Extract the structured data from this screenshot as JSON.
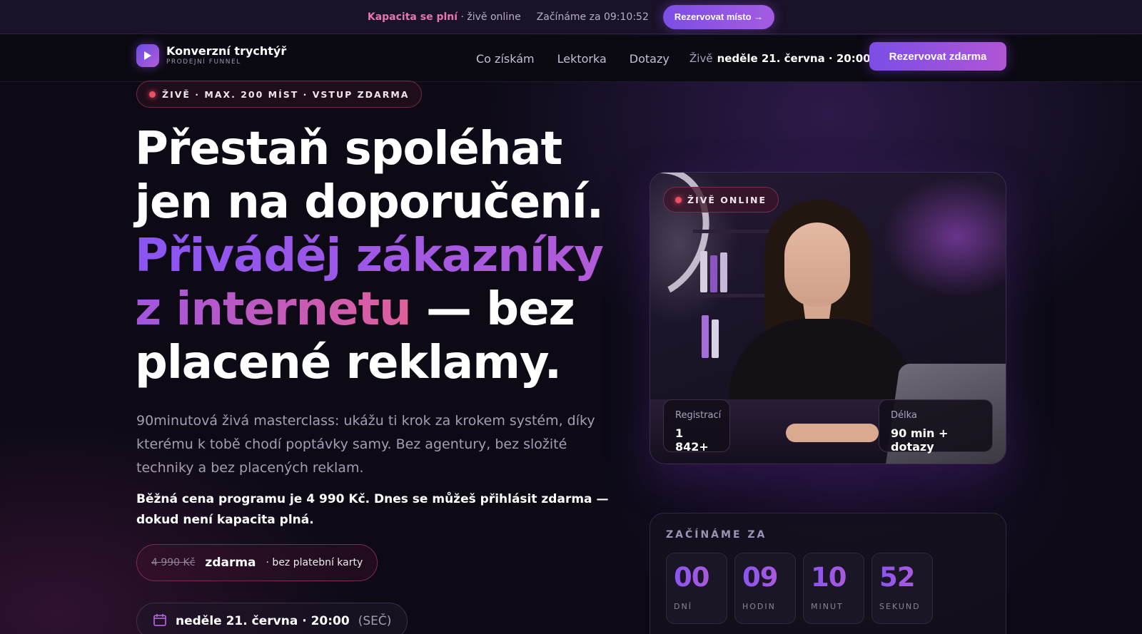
{
  "topbar": {
    "capacity": "Kapacita se plní",
    "online": "· živě online",
    "starts_label": "Začínáme za",
    "timer": "09:10:52",
    "cta": "Rezervovat místo →"
  },
  "nav": {
    "logo_title": "Konverzní trychtýř",
    "logo_sub": "PRODEJNÍ FUNNEL",
    "links": [
      "Co získám",
      "Lektorka",
      "Dotazy"
    ],
    "live_prefix": "Živě",
    "live_date": "neděle 21. června · 20:00",
    "cta": "Rezervovat zdarma"
  },
  "hero": {
    "badge": "ŽIVĚ · MAX. 200 MÍST · VSTUP ZDARMA",
    "headline": {
      "line1": "Přestaň spoléhat",
      "line2": "jen na doporučení.",
      "line3": "Přiváděj zákazníky",
      "line4_grad": "z internetu",
      "line4_rest": " — bez",
      "line5": "placené reklamy."
    },
    "lede": "90minutová živá masterclass: ukážu ti krok za krokem systém, díky kterému k tobě chodí poptávky samy. Bez agentury, bez složité techniky a bez placených reklam.",
    "note": "Běžná cena programu je 4 990 Kč. Dnes se můžeš přihlásit zdarma — dokud není kapacita plná.",
    "price": {
      "old": "4 990 Kč",
      "new": "zdarma",
      "note": "· bez platební karty"
    },
    "date": {
      "value": "neděle 21. června · 20:00",
      "tz": "(SEČ)"
    }
  },
  "photo": {
    "badge": "ŽIVĚ ONLINE",
    "stat1": {
      "label": "Registrací",
      "value": "1 842+"
    },
    "stat2": {
      "label": "Délka",
      "value": "90 min + dotazy"
    }
  },
  "countdown": {
    "title": "ZAČÍNÁME ZA",
    "units": [
      {
        "value": "00",
        "label": "DNÍ"
      },
      {
        "value": "09",
        "label": "HODIN"
      },
      {
        "value": "10",
        "label": "MINUT"
      },
      {
        "value": "52",
        "label": "SEKUND"
      }
    ]
  },
  "colors": {
    "accent": "#8a55f2",
    "accent_pink": "#e0609a",
    "live_dot": "#ec4f63",
    "background": "#0d0a16"
  },
  "icons": [
    "play-icon",
    "live-dot-icon",
    "calendar-icon"
  ]
}
